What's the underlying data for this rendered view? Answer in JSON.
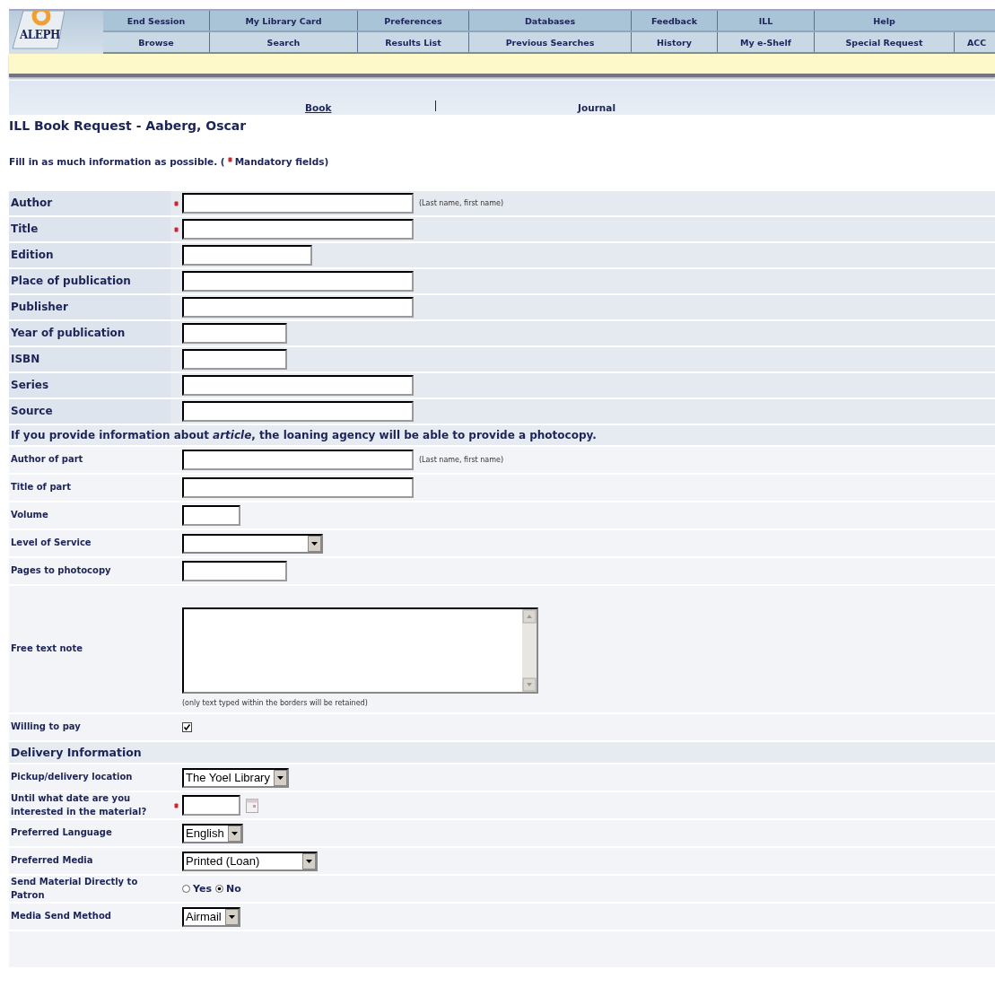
{
  "logo": {
    "text": "ALEPH"
  },
  "nav": {
    "primary": [
      "End Session",
      "My Library Card",
      "Preferences",
      "Databases",
      "Feedback",
      "ILL",
      "Help"
    ],
    "secondary": [
      "Browse",
      "Search",
      "Results List",
      "Previous Searches",
      "History",
      "My e-Shelf",
      "Special Request",
      "ACC"
    ]
  },
  "request_types": [
    {
      "label": "Book",
      "selected": false
    },
    {
      "label": "Journal",
      "selected": true
    }
  ],
  "heading": "ILL Book Request - Aaberg, Oscar",
  "instructions": {
    "before": "Fill in as much information as possible. (",
    "after": "Mandatory fields)"
  },
  "sections": [
    {
      "rows": [
        {
          "label": "Author",
          "kind": "text",
          "required": true,
          "hint": "(Last name, first name)"
        },
        {
          "label": "Title",
          "kind": "text",
          "required": true
        },
        {
          "label": "Edition",
          "kind": "text",
          "required": false
        },
        {
          "label": "Place of publication",
          "kind": "text",
          "required": false
        },
        {
          "label": "Publisher",
          "kind": "text",
          "required": false
        },
        {
          "label": "Year of publication",
          "kind": "text",
          "required": false
        },
        {
          "label": "ISBN",
          "kind": "text",
          "required": false
        },
        {
          "label": "Series",
          "kind": "text",
          "required": false
        },
        {
          "label": "Source",
          "kind": "text",
          "required": false
        }
      ]
    },
    {
      "header": "If you provide information about *article*, the loaning agency will be able to provide a photocopy.",
      "rows": [
        {
          "label": "Author of part",
          "kind": "text",
          "required": false,
          "hint": "(Last name, first name)"
        },
        {
          "label": "Title of part",
          "kind": "text",
          "required": false
        },
        {
          "label": "Volume",
          "kind": "text",
          "required": false
        },
        {
          "label": "Level of Service",
          "kind": "select",
          "required": false
        },
        {
          "label": "Pages to photocopy",
          "kind": "text",
          "required": false
        },
        {
          "label": "Free text note",
          "kind": "textarea",
          "required": false,
          "hint": "(only text typed within the borders will be retained)"
        },
        {
          "label": "Willing to pay",
          "kind": "checkbox",
          "checked": true,
          "required": false
        }
      ]
    },
    {
      "header": "Delivery Information",
      "rows": [
        {
          "label": "Pickup/delivery location",
          "kind": "select",
          "value": "The Yoel Library",
          "required": false
        },
        {
          "label": "Until what date are you interested in the material?",
          "kind": "date",
          "required": true
        },
        {
          "label": "Preferred Language",
          "kind": "select",
          "value": "English",
          "required": false
        },
        {
          "label": "Preferred Media",
          "kind": "select",
          "value": "Printed (Loan)",
          "required": false
        },
        {
          "label": "Send Material Directly to Patron",
          "kind": "radio",
          "required": false,
          "options": [
            {
              "label": "Yes",
              "selected": false
            },
            {
              "label": "No",
              "selected": true
            }
          ]
        },
        {
          "label": "Media Send Method",
          "kind": "select",
          "value": "Airmail",
          "required": false
        }
      ]
    }
  ]
}
